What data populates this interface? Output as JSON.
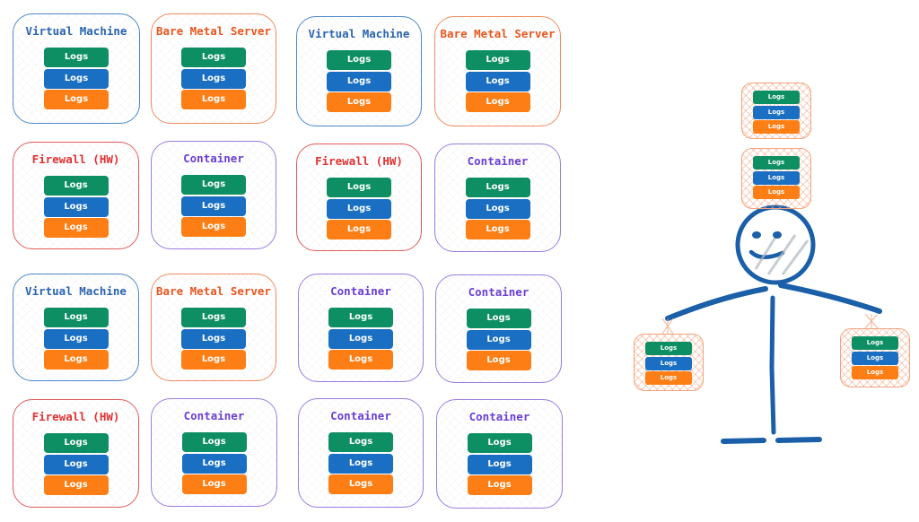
{
  "log_label": "Logs",
  "colors": {
    "log_layers": [
      "#0d8f63",
      "#1a6fc2",
      "#fd7e14"
    ],
    "types": {
      "vm": {
        "border": "#4a88c9",
        "title": "#2a64b0"
      },
      "bms": {
        "border": "#f08a5d",
        "title": "#e8561f"
      },
      "fw": {
        "border": "#e05a5a",
        "title": "#e03131"
      },
      "container": {
        "border": "#9a7ce0",
        "title": "#6a3fd6"
      }
    },
    "figure": "#1a5fa8"
  },
  "boxes": [
    {
      "label": "Virtual Machine",
      "type": "vm"
    },
    {
      "label": "Bare Metal Server",
      "type": "bms"
    },
    {
      "label": "Virtual Machine",
      "type": "vm"
    },
    {
      "label": "Bare Metal Server",
      "type": "bms"
    },
    {
      "label": "Firewall (HW)",
      "type": "fw"
    },
    {
      "label": "Container",
      "type": "container"
    },
    {
      "label": "Firewall (HW)",
      "type": "fw"
    },
    {
      "label": "Container",
      "type": "container"
    },
    {
      "label": "Virtual Machine",
      "type": "vm"
    },
    {
      "label": "Bare Metal Server",
      "type": "bms"
    },
    {
      "label": "Container",
      "type": "container"
    },
    {
      "label": "Container",
      "type": "container"
    },
    {
      "label": "Firewall (HW)",
      "type": "fw"
    },
    {
      "label": "Container",
      "type": "container"
    },
    {
      "label": "Container",
      "type": "container"
    },
    {
      "label": "Container",
      "type": "container"
    }
  ],
  "figure_stacks": [
    "head-top",
    "head-lower",
    "left-hand",
    "right-hand"
  ]
}
